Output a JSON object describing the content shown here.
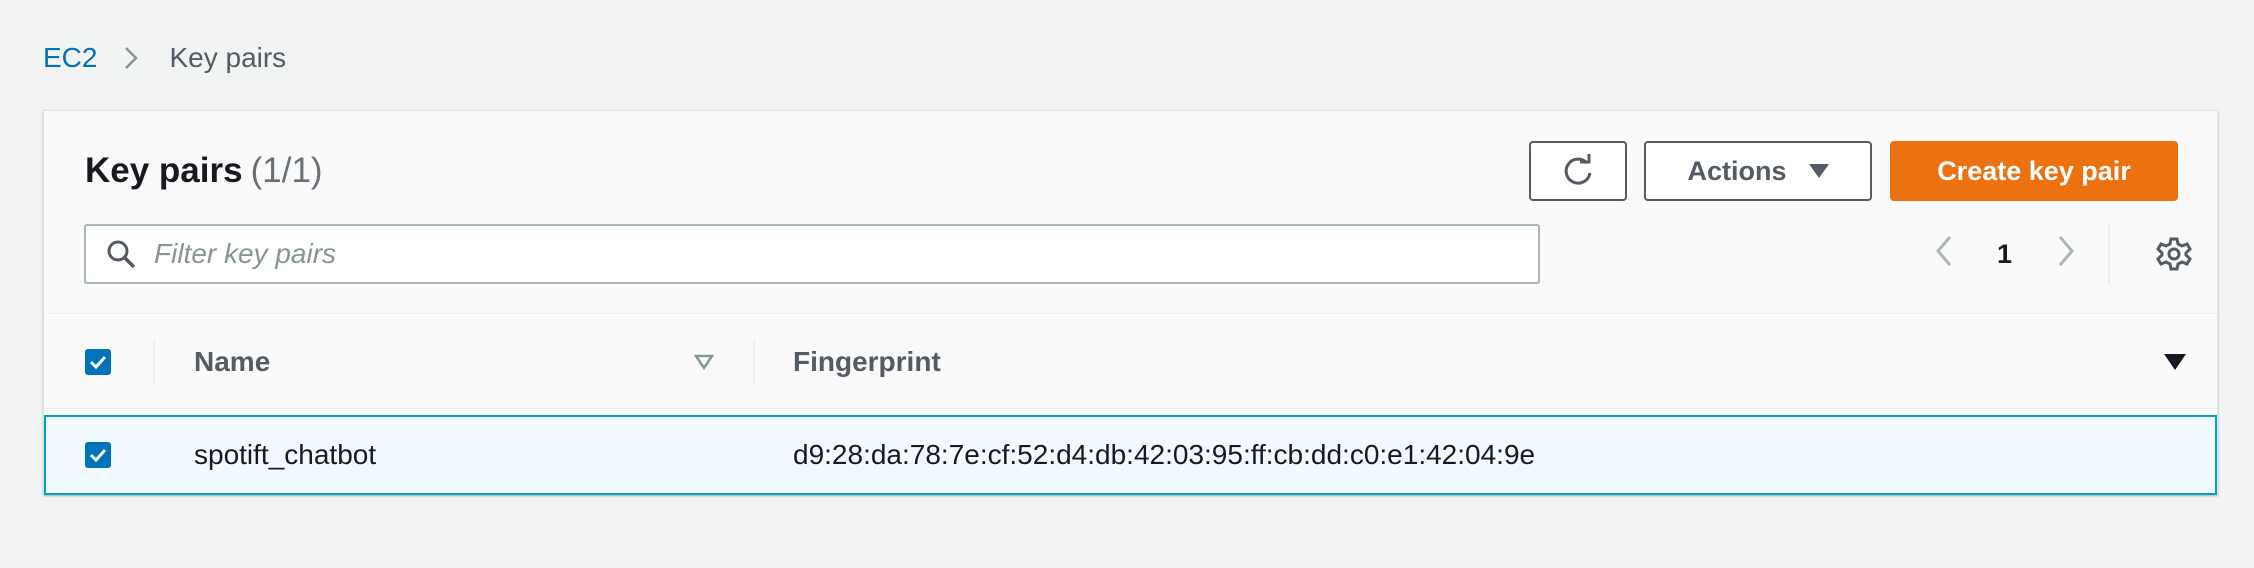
{
  "breadcrumb": {
    "root": "EC2",
    "current": "Key pairs"
  },
  "header": {
    "title": "Key pairs",
    "count": "(1/1)",
    "actions_label": "Actions",
    "create_label": "Create key pair"
  },
  "search": {
    "placeholder": "Filter key pairs",
    "value": ""
  },
  "pagination": {
    "current_page": "1"
  },
  "table": {
    "columns": [
      "Name",
      "Fingerprint"
    ],
    "rows": [
      {
        "selected": true,
        "name": "spotift_chatbot",
        "fingerprint": "d9:28:da:78:7e:cf:52:d4:db:42:03:95:ff:cb:dd:c0:e1:42:04:9e"
      }
    ]
  },
  "colors": {
    "accent": "#ec7211",
    "link": "#0073bb",
    "selection_border": "#00a1c9",
    "selection_bg": "#f1faff"
  },
  "icons": [
    "chevron-right-icon",
    "refresh-icon",
    "caret-down-icon",
    "search-icon",
    "chevron-left-icon",
    "gear-icon",
    "sort-icon",
    "checkmark-icon"
  ]
}
